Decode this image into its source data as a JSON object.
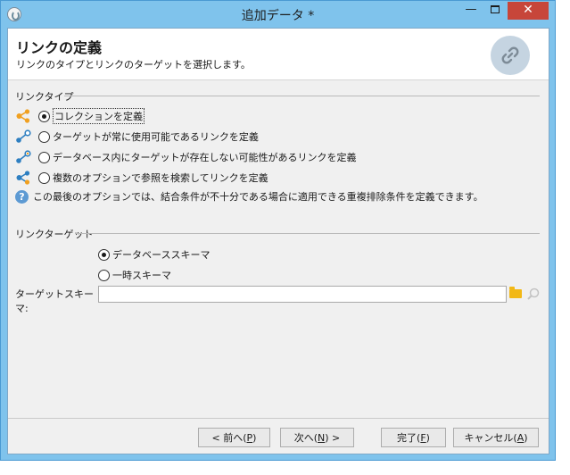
{
  "window": {
    "title": "追加データ *",
    "controls": {
      "minimize": "—",
      "close": "✕"
    }
  },
  "header": {
    "title": "リンクの定義",
    "subtitle": "リンクのタイプとリンクのターゲットを選択します。",
    "icon": "link-icon"
  },
  "link_type": {
    "label": "リンクタイプ",
    "options": [
      {
        "label": "コレクションを定義",
        "icon": "share-orange-icon",
        "selected": true
      },
      {
        "label": "ターゲットが常に使用可能であるリンクを定義",
        "icon": "link-blue-icon",
        "selected": false
      },
      {
        "label": "データベース内にターゲットが存在しない可能性があるリンクを定義",
        "icon": "link-blue-orange-icon",
        "selected": false
      },
      {
        "label": "複数のオプションで参照を検索してリンクを定義",
        "icon": "share-blue-orange-icon",
        "selected": false
      }
    ],
    "info": "この最後のオプションでは、結合条件が不十分である場合に適用できる重複排除条件を定義できます。"
  },
  "link_target": {
    "label": "リンクターゲット",
    "options": [
      {
        "label": "データベーススキーマ",
        "selected": true
      },
      {
        "label": "一時スキーマ",
        "selected": false
      }
    ],
    "schema_label": "ターゲットスキーマ:",
    "schema_value": ""
  },
  "buttons": {
    "prev": {
      "text": "< 前へ(",
      "key": "P",
      "end": ")"
    },
    "next": {
      "text": "次へ(",
      "key": "N",
      "end": ") >"
    },
    "finish": {
      "text": "完了(",
      "key": "F",
      "end": ")"
    },
    "cancel": {
      "text": "キャンセル(",
      "key": "A",
      "end": ")"
    }
  },
  "colors": {
    "title_bar": "#7fc3ec",
    "close_button": "#c7463a",
    "icon_orange": "#f0a020",
    "icon_blue": "#2e7fc1"
  }
}
